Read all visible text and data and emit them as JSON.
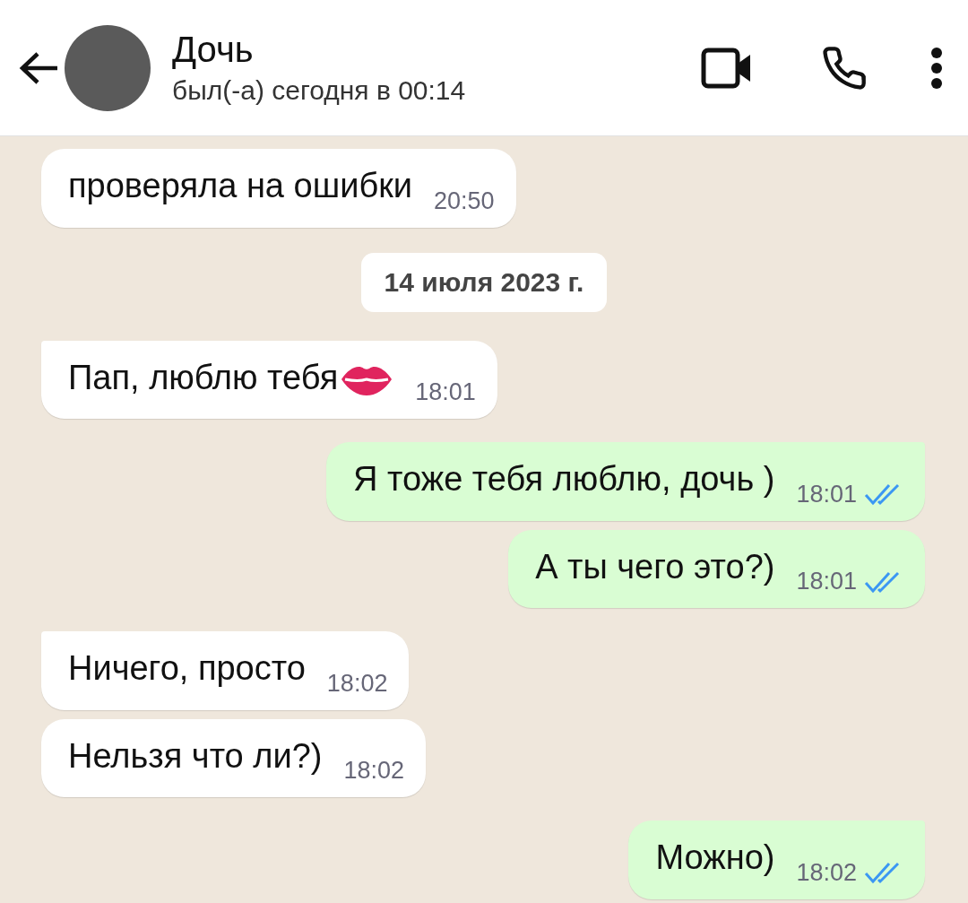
{
  "header": {
    "name": "Дочь",
    "status": "был(-а) сегодня в 00:14"
  },
  "messages": [
    {
      "kind": "incoming",
      "text": "проверяла на ошибки",
      "time": "20:50",
      "tail": false,
      "emoji": false
    },
    {
      "kind": "date",
      "text": "14 июля 2023 г."
    },
    {
      "kind": "incoming",
      "text": "Пап, люблю тебя",
      "time": "18:01",
      "tail": true,
      "emoji": true
    },
    {
      "kind": "outgoing",
      "text": "Я тоже тебя люблю, дочь )",
      "time": "18:01",
      "tail": true,
      "read": true
    },
    {
      "kind": "outgoing",
      "text": "А ты чего это?)",
      "time": "18:01",
      "tail": false,
      "read": true
    },
    {
      "kind": "incoming",
      "text": "Ничего, просто",
      "time": "18:02",
      "tail": true,
      "emoji": false
    },
    {
      "kind": "incoming",
      "text": "Нельзя что ли?)",
      "time": "18:02",
      "tail": false,
      "emoji": false
    },
    {
      "kind": "outgoing",
      "text": "Можно)",
      "time": "18:02",
      "tail": true,
      "read": true
    }
  ]
}
